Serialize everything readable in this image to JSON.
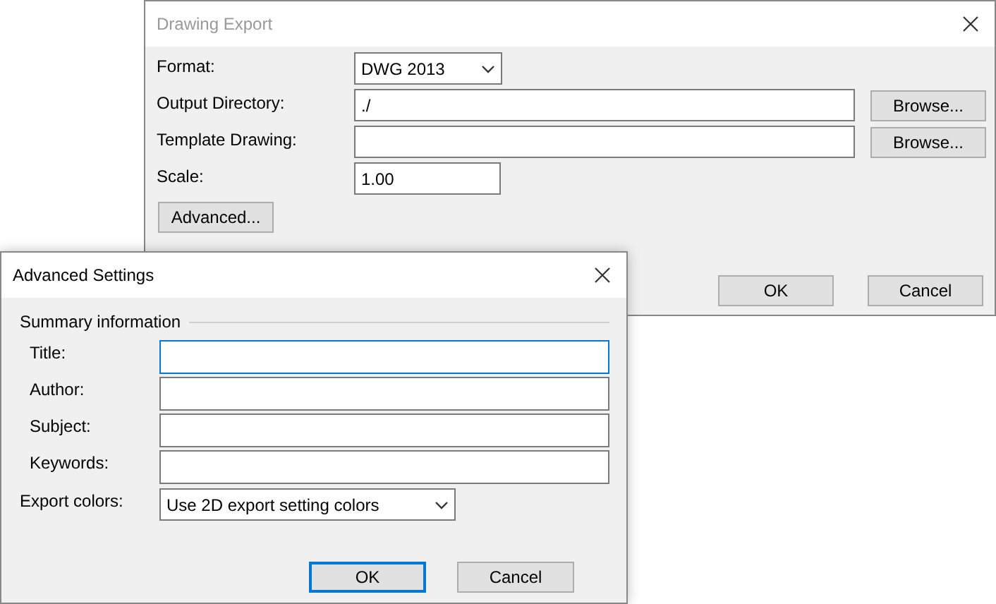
{
  "export_dialog": {
    "title": "Drawing Export",
    "active": false,
    "fields": [
      {
        "kind": "dropdown",
        "label": "Format:",
        "value": "DWG 2013"
      },
      {
        "kind": "text",
        "label": "Output Directory:",
        "value": "./",
        "button": "Browse..."
      },
      {
        "kind": "text",
        "label": "Template Drawing:",
        "button": "Browse..."
      },
      {
        "kind": "short",
        "label": "Scale:",
        "value": "1.00"
      }
    ],
    "advanced_button": "Advanced...",
    "buttons": [
      {
        "label": "OK",
        "default": false
      },
      {
        "label": "Cancel",
        "default": false
      }
    ]
  },
  "advanced_dialog": {
    "title": "Advanced Settings",
    "active": true,
    "group": "Summary information",
    "fields": [
      {
        "label": "Title:",
        "focused": true
      },
      {
        "label": "Author:",
        "focused": false
      },
      {
        "label": "Subject:",
        "focused": false
      },
      {
        "label": "Keywords:",
        "focused": false
      }
    ],
    "export_colors": {
      "label": "Export colors:",
      "value": "Use 2D export setting colors"
    },
    "buttons": [
      {
        "label": "OK",
        "default": true
      },
      {
        "label": "Cancel",
        "default": false
      }
    ]
  }
}
